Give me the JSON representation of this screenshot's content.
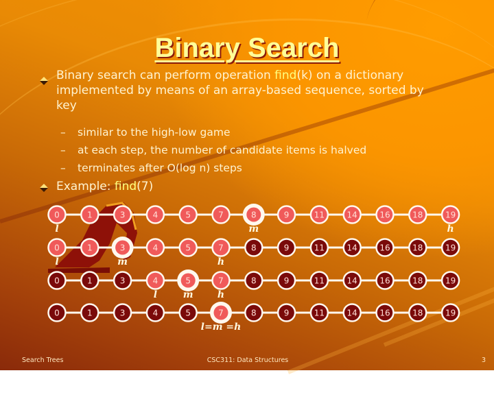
{
  "slide": {
    "title": "Binary Search",
    "bullets": [
      {
        "parts": [
          {
            "text": "Binary search can perform operation ",
            "hl": false
          },
          {
            "text": "find",
            "hl": true
          },
          {
            "text": "(k) on a dictionary implemented by means of an array-based sequence, sorted by key",
            "hl": false
          }
        ],
        "sub": [
          "similar to the high-low game",
          "at each step, the number of candidate items is halved",
          "terminates after O(log n) steps"
        ]
      },
      {
        "parts": [
          {
            "text": "Example: ",
            "hl": false
          },
          {
            "text": "find",
            "hl": true
          },
          {
            "text": "(7)",
            "hl": false
          }
        ]
      }
    ],
    "sub_dash": "–"
  },
  "array": {
    "values": [
      "0",
      "1",
      "3",
      "4",
      "5",
      "7",
      "8",
      "9",
      "11",
      "14",
      "16",
      "18",
      "19"
    ],
    "steps": [
      {
        "active": [
          0,
          12
        ],
        "mid": 6,
        "labels": [
          {
            "index": 0,
            "text": "l"
          },
          {
            "index": 6,
            "text": "m"
          },
          {
            "index": 12,
            "text": "h"
          }
        ]
      },
      {
        "active": [
          0,
          5
        ],
        "mid": 2,
        "labels": [
          {
            "index": 0,
            "text": "l"
          },
          {
            "index": 2,
            "text": "m"
          },
          {
            "index": 5,
            "text": "h"
          }
        ]
      },
      {
        "active": [
          3,
          5
        ],
        "mid": 4,
        "labels": [
          {
            "index": 3,
            "text": "l"
          },
          {
            "index": 4,
            "text": "m"
          },
          {
            "index": 5,
            "text": "h"
          }
        ]
      },
      {
        "active": [
          5,
          5
        ],
        "mid": 5,
        "labels": [
          {
            "index": 5,
            "text": "l=m =h"
          }
        ]
      }
    ],
    "colors": {
      "active": "#f05a5a",
      "eliminated": "#7a0a0a",
      "ring": "#fff8ee",
      "label": "#fff8e0"
    }
  },
  "footer": {
    "left": "Search Trees",
    "center": "CSC311: Data Structures",
    "page": "3"
  }
}
